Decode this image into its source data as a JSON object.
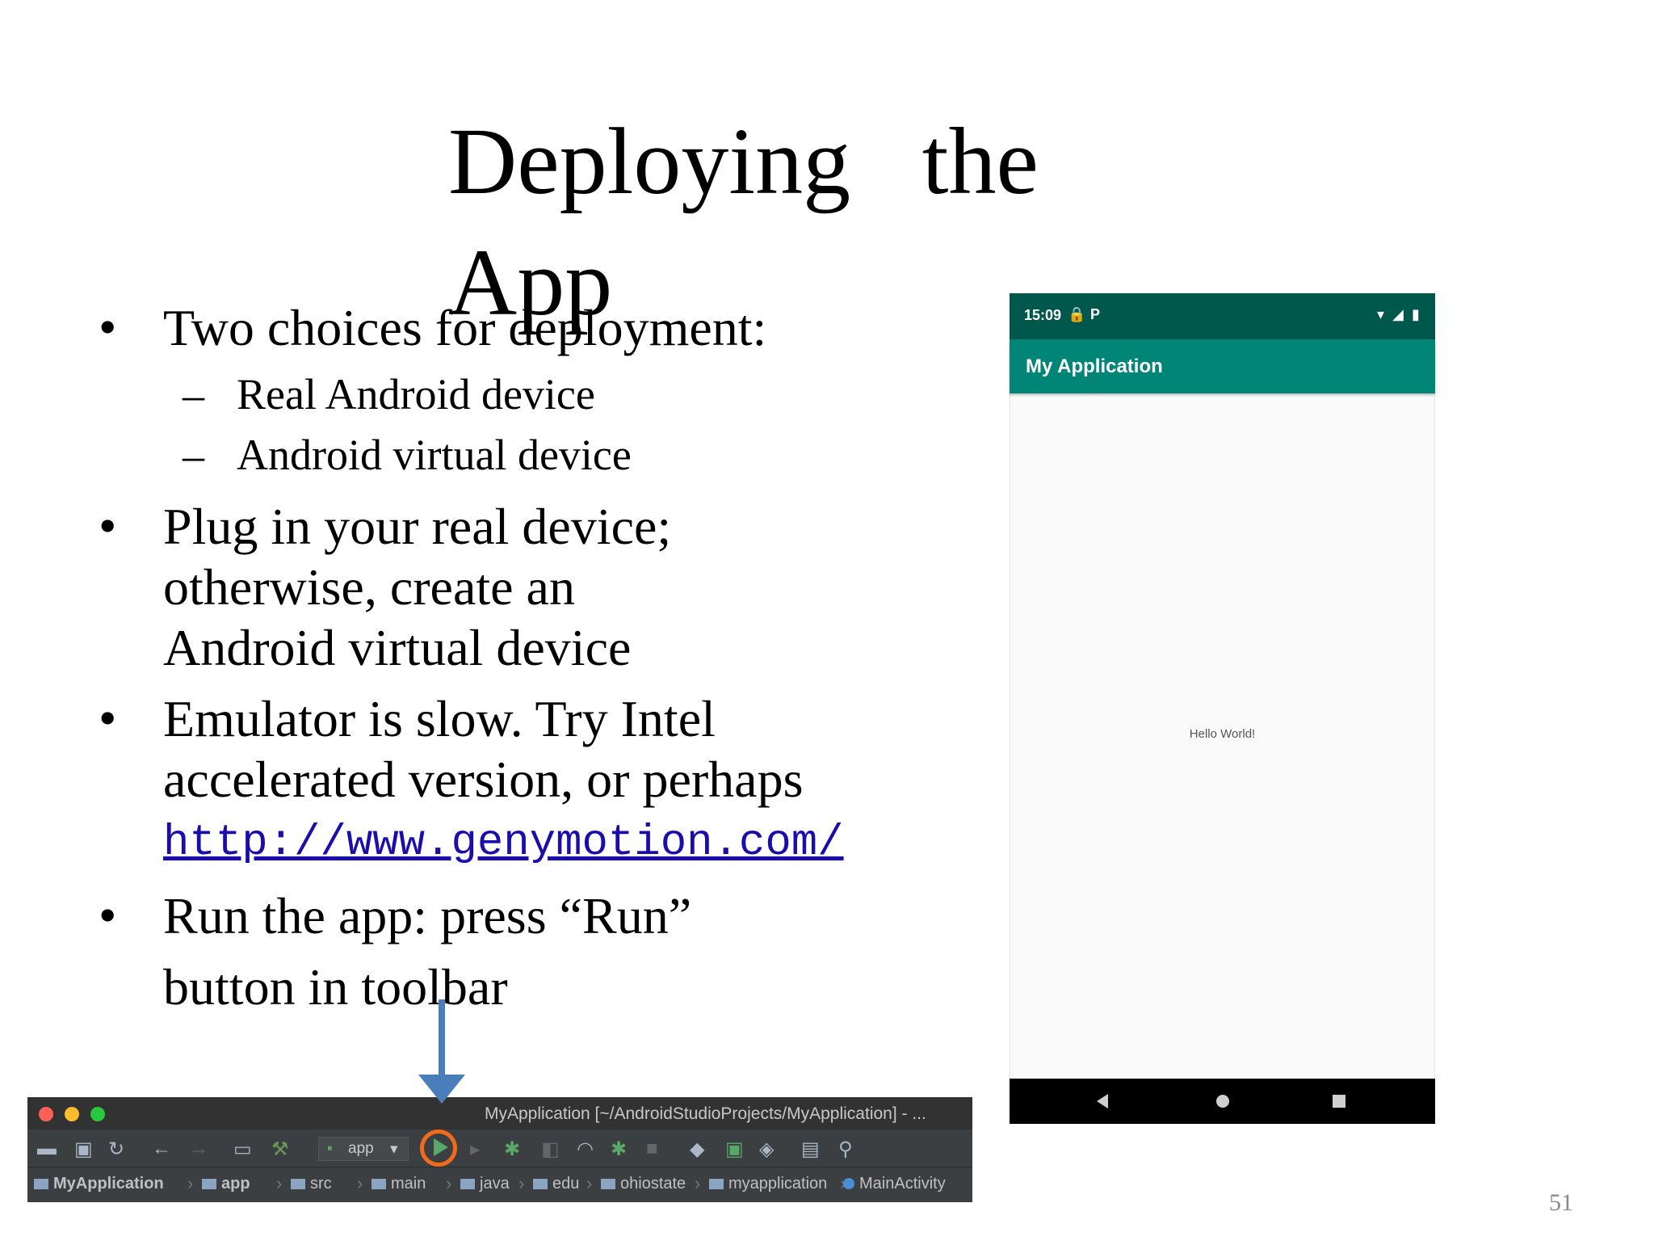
{
  "slide": {
    "title": "Deploying   the\nApp",
    "bullets": [
      {
        "text": "Two choices for deployment:"
      },
      {
        "sub": [
          "Real Android device",
          "Android virtual device"
        ]
      },
      {
        "lines": [
          "Plug in your real device;",
          "otherwise, create an",
          "Android  virtual device"
        ]
      },
      {
        "lines": [
          "Emulator is slow. Try Intel",
          "accelerated version, or perhaps"
        ],
        "link": "http://www.genymotion.com/"
      },
      {
        "lines": [
          "Run the app: press “Run”",
          "button in toolbar"
        ]
      }
    ],
    "page_number": "51"
  },
  "phone": {
    "status_time": "15:09",
    "app_title": "My Application",
    "content_text": "Hello World!"
  },
  "ide_toolbar": {
    "window_title": "MyApplication [~/AndroidStudioProjects/MyApplication] - ...",
    "run_config": "app",
    "breadcrumb": [
      "MyApplication",
      "app",
      "src",
      "main",
      "java",
      "edu",
      "ohiostate",
      "myapplication",
      "MainActivity"
    ]
  },
  "colors": {
    "status_bar": "#00574b",
    "app_bar": "#008577",
    "run_highlight": "#f26b1d",
    "arrow": "#4a7ebb",
    "link": "#1a0dab"
  }
}
